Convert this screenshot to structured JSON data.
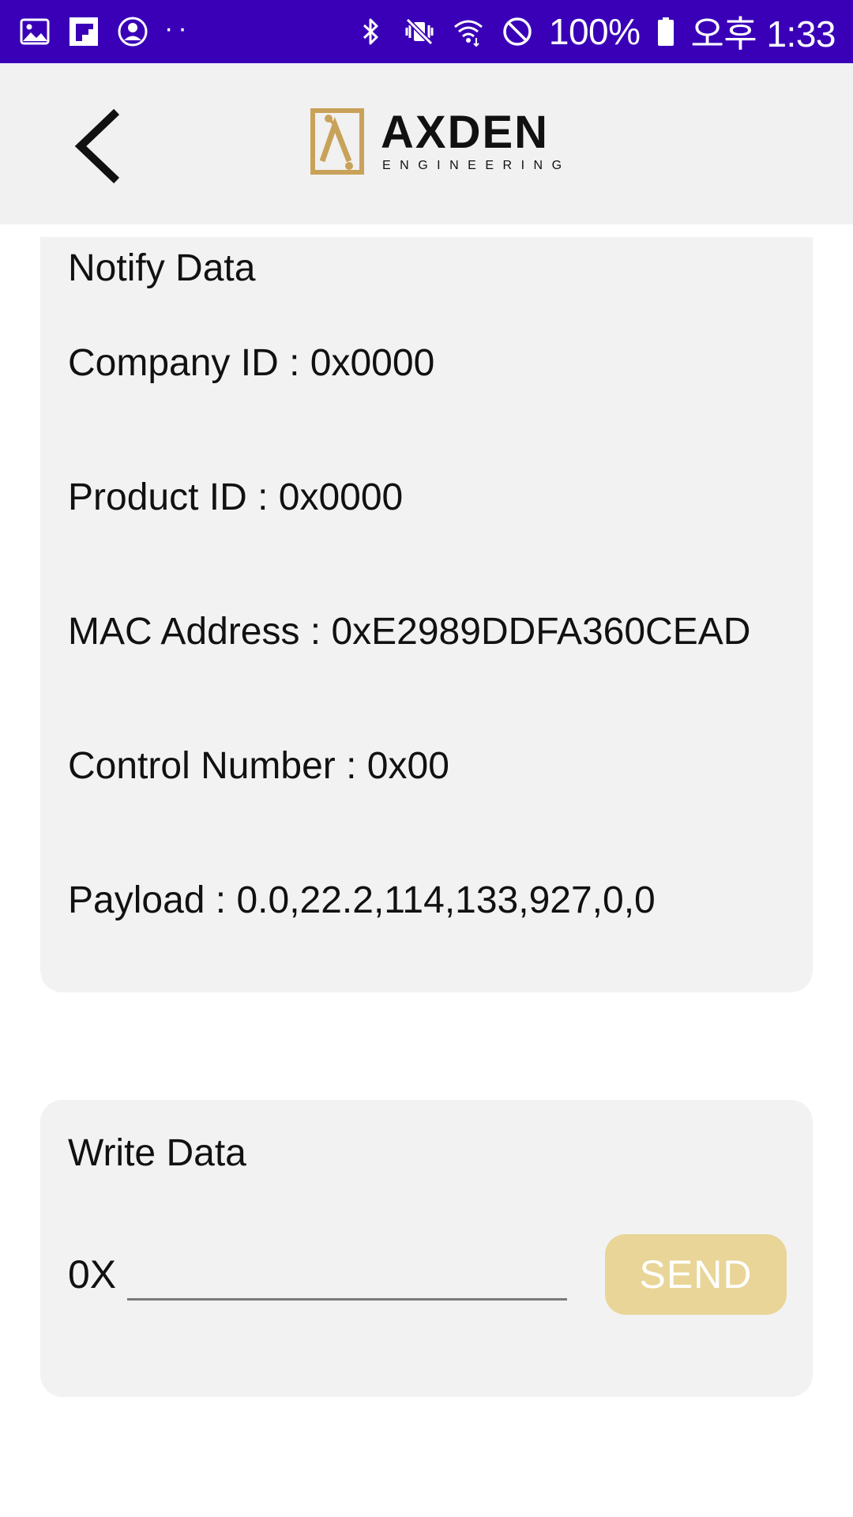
{
  "status_bar": {
    "battery": "100%",
    "time": "오후 1:33",
    "dots": "··",
    "icons": [
      "gallery-icon",
      "flipboard-icon",
      "account-icon",
      "bluetooth-icon",
      "vibrate-off-icon",
      "wifi-icon",
      "do-not-disturb-icon",
      "battery-icon"
    ]
  },
  "header": {
    "back_icon": "chevron-left-icon",
    "logo_main": "AXDEN",
    "logo_sub": "ENGINEERING",
    "colors": {
      "logo_gold": "#c9a25a"
    }
  },
  "notify": {
    "title": "Notify Data",
    "fields": [
      {
        "label": "Company ID : ",
        "value": "0x0000"
      },
      {
        "label": "Product ID : ",
        "value": "0x0000"
      },
      {
        "label": "MAC Address : ",
        "value": "0xE2989DDFA360CEAD"
      },
      {
        "label": "Control Number : ",
        "value": "0x00"
      },
      {
        "label": "Payload : ",
        "value": "0.0,22.2,114,133,927,0,0"
      }
    ]
  },
  "write": {
    "title": "Write Data",
    "prefix": "0X",
    "input_value": "",
    "send_label": "SEND",
    "colors": {
      "send_bg": "#e9d597"
    }
  },
  "colors": {
    "status_bar": "#3a00b8",
    "app_bar": "#f1f1f1",
    "card_bg": "#f2f2f2"
  }
}
